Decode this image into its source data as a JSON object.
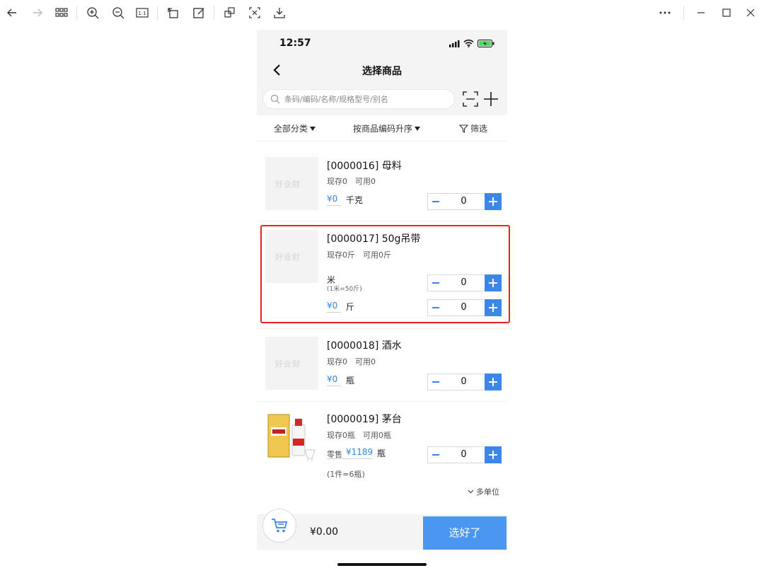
{
  "viewer": {
    "icons": [
      "back-arrow-icon",
      "forward-arrow-icon",
      "grid-icon",
      "zoom-in-icon",
      "zoom-out-icon",
      "actual-size-icon",
      "rotate-icon",
      "edit-icon",
      "copy-icon",
      "crop-icon",
      "download-icon",
      "more-icon",
      "minimize-icon",
      "maximize-icon",
      "close-icon"
    ],
    "actual_size_label": "1:1"
  },
  "status_bar": {
    "time": "12:57"
  },
  "header": {
    "title": "选择商品"
  },
  "search": {
    "placeholder": "条码/编码/名称/规格型号/别名"
  },
  "filters": {
    "category": "全部分类",
    "sort": "按商品编码升序",
    "filter": "筛选"
  },
  "watermark": "好业财",
  "items": [
    {
      "name": "[0000016] 母料",
      "stock": "现存0　可用0",
      "price": "¥0",
      "unit": "千克",
      "qty": "0"
    },
    {
      "name": "[0000017] 50g吊带",
      "stock": "现存0斤　可用0斤",
      "unit1": "米",
      "unit1_note": "(1米=50斤)",
      "qty1": "0",
      "price": "¥0",
      "unit2": "斤",
      "qty2": "0"
    },
    {
      "name": "[0000018] 酒水",
      "stock": "现存0　可用0",
      "price": "¥0",
      "unit": "瓶",
      "qty": "0"
    },
    {
      "name": "[0000019] 茅台",
      "stock": "现存0瓶　可用0瓶",
      "price_label": "零售",
      "price": "¥1189",
      "unit": "瓶",
      "unit_note": "(1件=6瓶)",
      "qty": "0",
      "multi_unit": "多单位"
    }
  ],
  "footer": {
    "total": "¥0.00",
    "confirm": "选好了"
  },
  "colors": {
    "accent": "#3b86e6",
    "highlight_box": "#e8231f",
    "price": "#2f86e8"
  }
}
